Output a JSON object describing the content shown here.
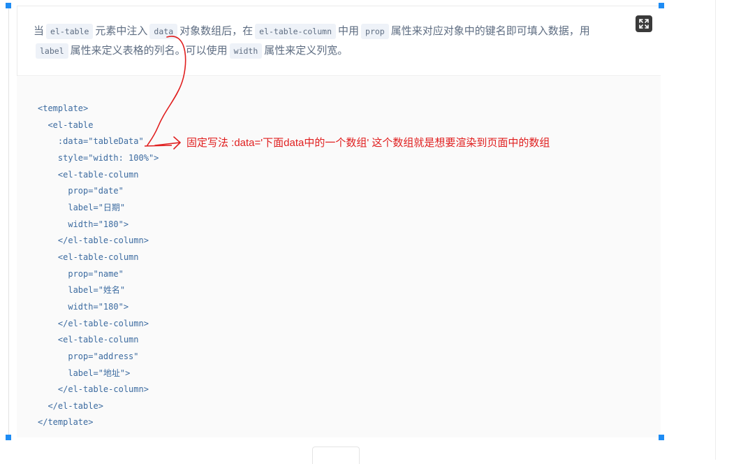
{
  "description": {
    "seg1": "当",
    "code1": "el-table",
    "seg2": "元素中注入",
    "code2": "data",
    "seg3": "对象数组后，在",
    "code3": "el-table-column",
    "seg4": "中用",
    "code4": "prop",
    "seg5": "属性来对应对象中的键名即可填入数据，用",
    "code5": "label",
    "seg6": "属性来定义表格的列名。可以使用",
    "code6": "width",
    "seg7": "属性来定义列宽。"
  },
  "code_lines": [
    "<template>",
    "  <el-table",
    "    :data=\"tableData\"",
    "    style=\"width: 100%\">",
    "    <el-table-column",
    "      prop=\"date\"",
    "      label=\"日期\"",
    "      width=\"180\">",
    "    </el-table-column>",
    "    <el-table-column",
    "      prop=\"name\"",
    "      label=\"姓名\"",
    "      width=\"180\">",
    "    </el-table-column>",
    "    <el-table-column",
    "      prop=\"address\"",
    "      label=\"地址\">",
    "    </el-table-column>",
    "  </el-table>",
    "</template>"
  ],
  "annotation": {
    "text": "固定写法 :data='下面data中的一个数组' 这个数组就是想要渲染到页面中的数组",
    "color": "#e01e1e"
  },
  "icons": {
    "expand": "expand-fullscreen-icon"
  },
  "colors": {
    "handle": "#1e8cf4",
    "code_text": "#3c6ba0",
    "description_text": "#5e6d82"
  }
}
